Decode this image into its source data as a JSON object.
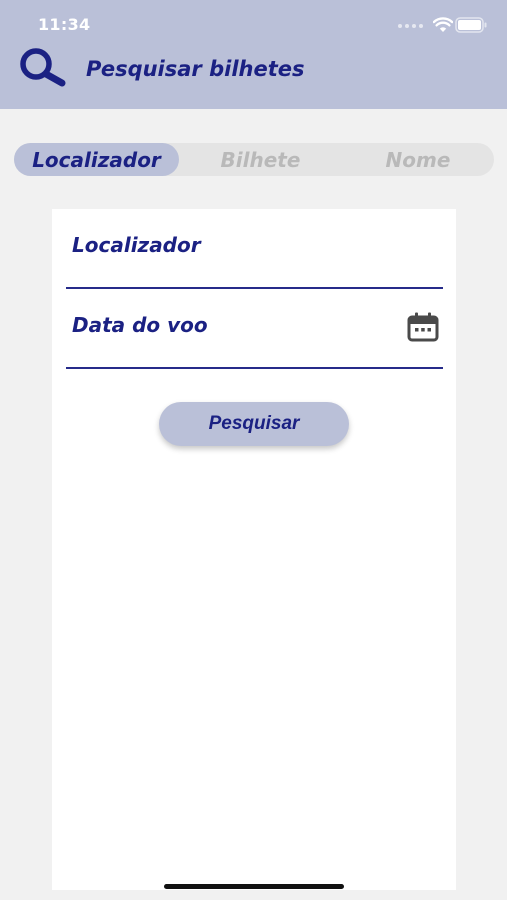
{
  "status_bar": {
    "time": "11:34"
  },
  "header": {
    "title": "Pesquisar bilhetes",
    "icon": "search-icon"
  },
  "tabs": [
    {
      "label": "Localizador",
      "active": true
    },
    {
      "label": "Bilhete",
      "active": false
    },
    {
      "label": "Nome",
      "active": false
    }
  ],
  "form": {
    "fields": [
      {
        "placeholder": "Localizador",
        "value": ""
      },
      {
        "placeholder": "Data do voo",
        "value": "",
        "icon": "calendar-icon"
      }
    ],
    "submit_label": "Pesquisar"
  },
  "colors": {
    "header_bg": "#bac0d8",
    "accent": "#1b2183",
    "inactive_tab_text": "#b9b9b9",
    "page_bg": "#f1f1f1"
  }
}
